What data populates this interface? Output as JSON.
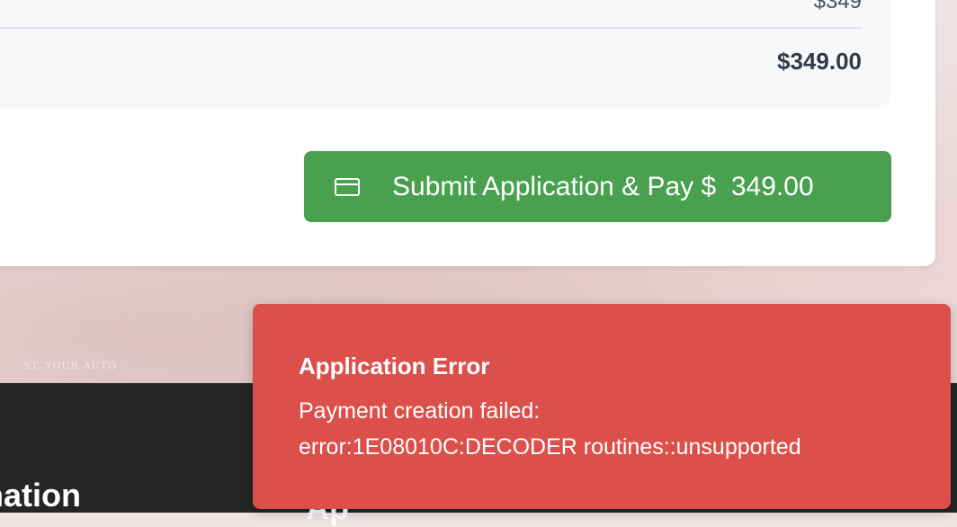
{
  "background": {
    "faint_text": "ST. YOUR AUTO"
  },
  "summary": {
    "price_partial": "$349",
    "total": "$349.00"
  },
  "submit_button": {
    "label": "Submit Application & Pay $  349.00",
    "icon": "credit-card-icon",
    "color": "#49a150"
  },
  "footer": {
    "heading_left_partial": "nation",
    "heading_right_partial": "Ap"
  },
  "toast": {
    "title": "Application Error",
    "message": "Payment creation failed:\nerror:1E08010C:DECODER routines::unsupported",
    "color": "#dc504c"
  }
}
